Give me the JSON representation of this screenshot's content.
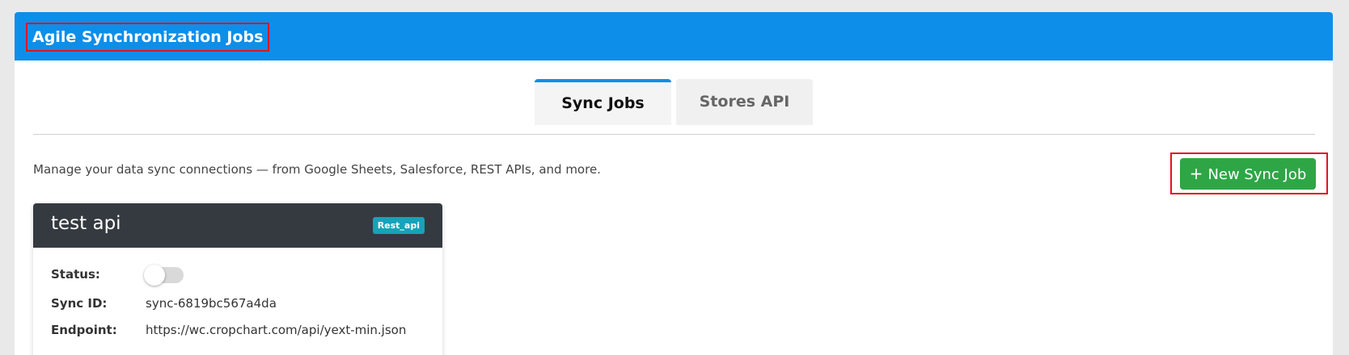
{
  "header": {
    "title": "Agile Synchronization Jobs"
  },
  "tabs": [
    {
      "label": "Sync Jobs",
      "active": true
    },
    {
      "label": "Stores API",
      "active": false
    }
  ],
  "description": "Manage your data sync connections — from Google Sheets, Salesforce, REST APIs, and more.",
  "new_job_button": {
    "icon": "plus-icon",
    "label": "New Sync Job"
  },
  "job_card": {
    "title": "test api",
    "type_badge": "Rest_api",
    "status_label": "Status:",
    "status_enabled": false,
    "sync_id_label": "Sync ID:",
    "sync_id": "sync-6819bc567a4da",
    "endpoint_label": "Endpoint:",
    "endpoint": "https://wc.cropchart.com/api/yext-min.json"
  },
  "colors": {
    "header_bg": "#0d8ee9",
    "card_header_bg": "#343a40",
    "success": "#2ea646",
    "info_badge": "#17a2b8",
    "highlight": "#e0151f"
  }
}
